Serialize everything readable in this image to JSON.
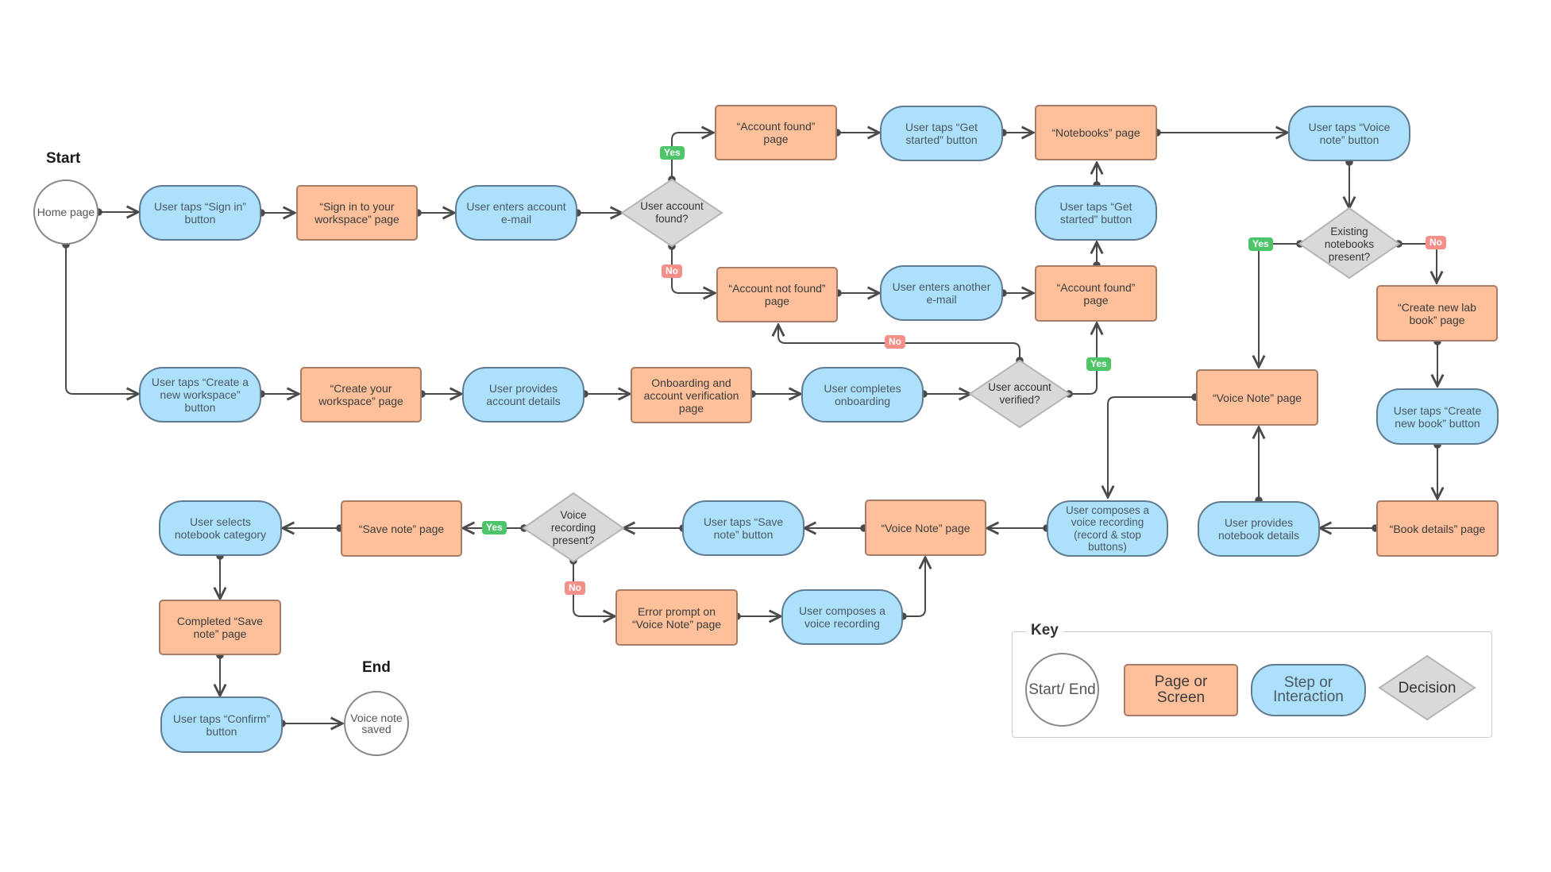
{
  "labels": {
    "start": "Start",
    "end": "End"
  },
  "nodes": {
    "home": "Home page",
    "tap_sign_in": "User taps “Sign in” button",
    "sign_in_page": "“Sign in to your workspace” page",
    "enter_email": "User enters account e-mail",
    "dec_account_found": "User account found?",
    "account_found_top": "“Account found” page",
    "get_started_top": "User taps “Get started” button",
    "notebooks_page": "“Notebooks” page",
    "tap_voice_note": "User taps “Voice note” button",
    "get_started_mid": "User taps “Get started” button",
    "account_not_found": "“Account not found” page",
    "enter_another_email": "User enters another e-mail",
    "account_found_mid": "“Account found” page",
    "tap_create_workspace": "User taps “Create a new workspace” button",
    "create_workspace_page": "“Create your workspace” page",
    "provide_account_details": "User provides account details",
    "onboarding_page": "Onboarding and account verification page",
    "complete_onboarding": "User completes onboarding",
    "dec_verified": "User account verified?",
    "dec_existing_notebooks": "Existing notebooks present?",
    "create_lab_book_page": "“Create new lab book” page",
    "voice_note_page_right": "“Voice Note” page",
    "tap_create_book": "User taps “Create new book” button",
    "book_details_page": "“Book details” page",
    "provide_notebook_details": "User provides notebook details",
    "compose_record_stop": "User composes a voice recording (record & stop buttons)",
    "voice_note_page_bottom": "“Voice Note” page",
    "tap_save_note": "User taps “Save note” button",
    "dec_voice_present": "Voice recording present?",
    "save_note_page": "“Save note” page",
    "select_category": "User selects notebook category",
    "completed_save_page": "Completed “Save note” page",
    "tap_confirm": "User taps “Confirm” button",
    "voice_note_saved": "Voice note saved",
    "error_prompt": "Error prompt on “Voice Note” page",
    "compose_recording": "User composes a voice recording"
  },
  "badges": {
    "yes": "Yes",
    "no": "No"
  },
  "key": {
    "title": "Key",
    "start_end": "Start/ End",
    "page": "Page or Screen",
    "step": "Step or Interaction",
    "decision": "Decision"
  },
  "colors": {
    "page_fill": "#fdc09a",
    "step_fill": "#ade0fa",
    "decision_fill": "#d9d9d9",
    "yes_badge": "#4fc56a",
    "no_badge": "#f48f8a",
    "connector": "#4a4a4a"
  }
}
